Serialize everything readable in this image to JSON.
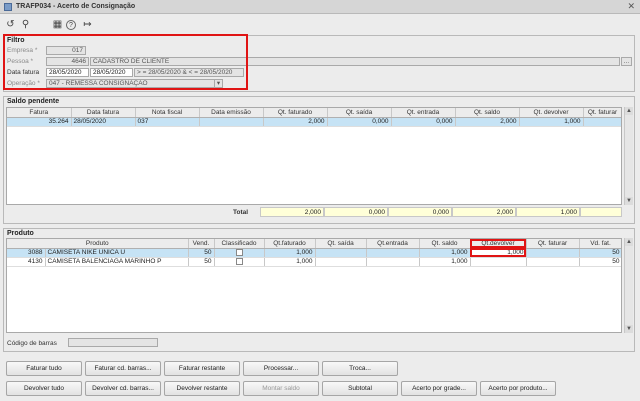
{
  "window": {
    "title": "TRAFP034 - Acerto de Consignação",
    "close_glyph": "✕"
  },
  "toolbar": {
    "icons": [
      "undo-icon",
      "search-icon",
      "calendar-icon",
      "help-icon",
      "exit-icon"
    ],
    "glyphs": [
      "↺",
      "⚲",
      "▦",
      "?",
      "↦"
    ]
  },
  "filtro": {
    "legend": "Filtro",
    "empresa": {
      "label": "Empresa *",
      "value": "017"
    },
    "pessoa": {
      "label": "Pessoa *",
      "code": "4646",
      "name": "CADASTRO DE CLIENTE",
      "lookup": "..."
    },
    "data_fatura": {
      "label": "Data fatura",
      "from": "28/05/2020",
      "to": "28/05/2020",
      "range_text": "> = 28/05/2020  & < = 28/05/2020"
    },
    "operacao": {
      "label": "Operação *",
      "value": "047 - REMESSA CONSIGNAÇÃO",
      "arrow": "▾"
    }
  },
  "saldo": {
    "legend": "Saldo pendente",
    "columns": [
      "Fatura",
      "Data fatura",
      "Nota fiscal",
      "Data emissão",
      "Qt. faturado",
      "Qt. saída",
      "Qt. entrada",
      "Qt. saldo",
      "Qt. devolver",
      "Qt. faturar"
    ],
    "rows": [
      [
        "35.264",
        "28/05/2020",
        "037",
        "",
        "2,000",
        "0,000",
        "0,000",
        "2,000",
        "1,000",
        ""
      ]
    ],
    "total_label": "Total",
    "totals": [
      "2,000",
      "0,000",
      "0,000",
      "2,000",
      "1,000",
      ""
    ]
  },
  "produto": {
    "legend": "Produto",
    "columns": [
      "Produto",
      "Vend.",
      "Classificado",
      "Qt.faturado",
      "Qt. saída",
      "Qt.entrada",
      "Qt. saldo",
      "Qt.devolver",
      "Qt. faturar",
      "Vd. fat.",
      "»"
    ],
    "rows": [
      {
        "code": "3088",
        "name": "CAMISETA NIKE UNICA U",
        "vend": "50",
        "faturado": "1,000",
        "saida": "",
        "entrada": "",
        "saldo": "1,000",
        "devolver": "1,000",
        "faturar": "",
        "vd": "50"
      },
      {
        "code": "4130",
        "name": "CAMISETA BALENCIAGA MARINHO P",
        "vend": "50",
        "faturado": "1,000",
        "saida": "",
        "entrada": "",
        "saldo": "1,000",
        "devolver": "",
        "faturar": "",
        "vd": "50"
      }
    ],
    "barcode_label": "Código de barras",
    "barcode_value": ""
  },
  "buttons": {
    "faturar_tudo": "Faturar tudo",
    "faturar_cd": "Faturar cd. barras...",
    "faturar_restante": "Faturar restante",
    "processar": "Processar...",
    "troca": "Troca...",
    "devolver_tudo": "Devolver tudo",
    "devolver_cd": "Devolver cd. barras...",
    "devolver_restante": "Devolver restante",
    "montar_saldo": "Montar saldo",
    "subtotal": "Subtotal",
    "acerto_grade": "Acerto por grade...",
    "acerto_produto": "Acerto por produto..."
  }
}
